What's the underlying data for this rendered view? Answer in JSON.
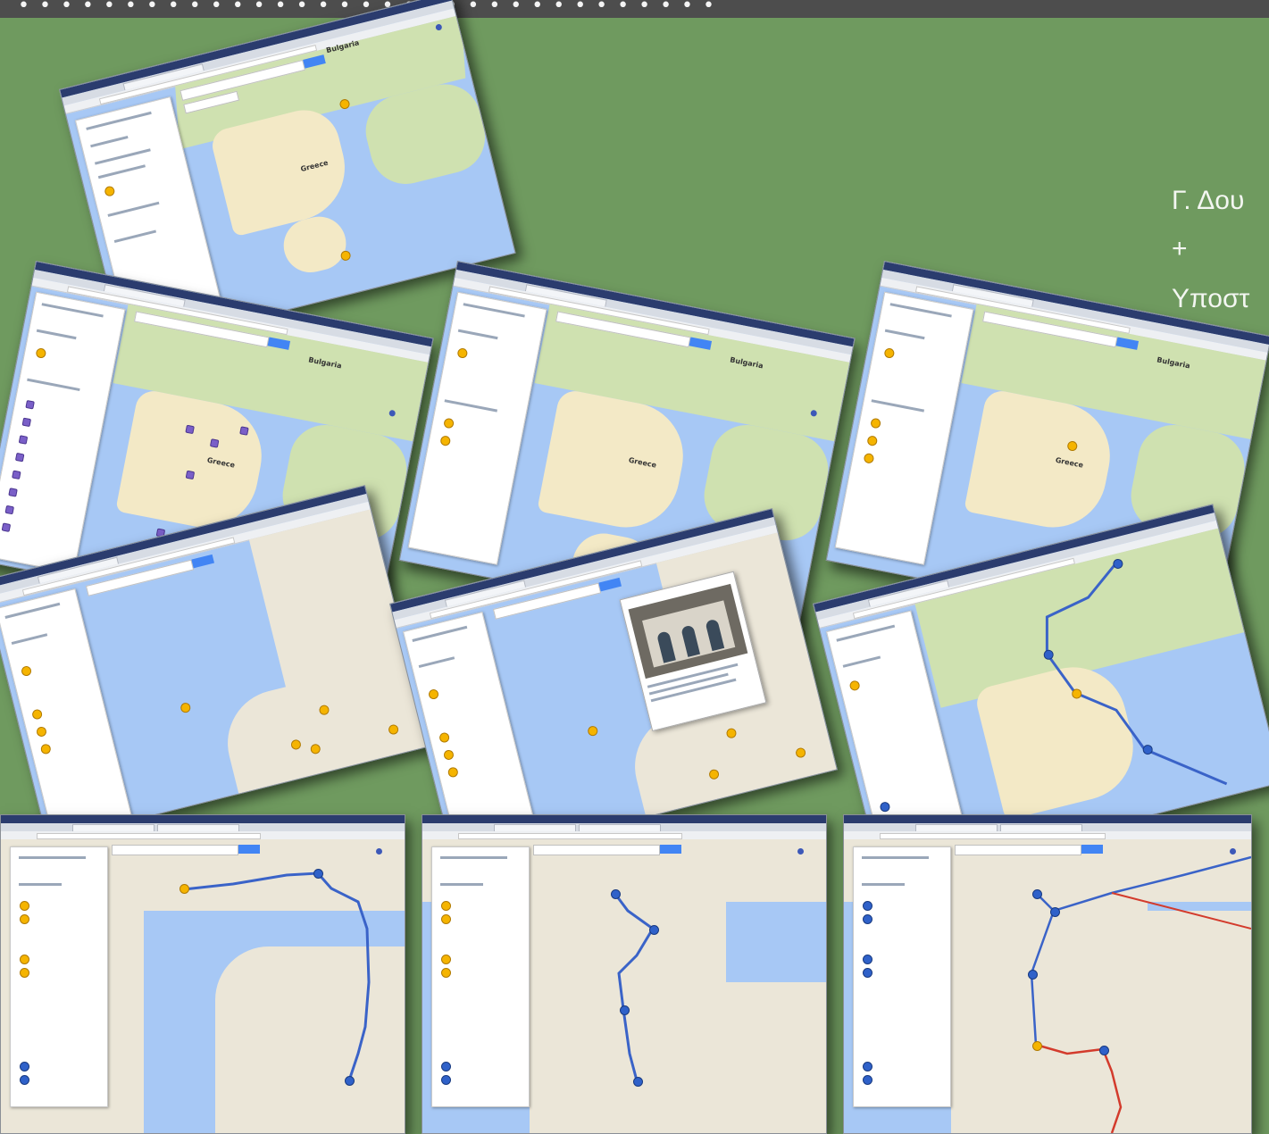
{
  "header": {
    "top_strip_text": "• •   •  • •   •     • • •     • •   •   • • •    •    •    • • •    •    •  •    •   •   • • •  •   •   •  •   •",
    "side_line1": "Γ. Δου",
    "side_line2": "+",
    "side_line3": "Υποστ"
  },
  "map_labels": {
    "bulgaria": "Bulgaria",
    "greece": "Greece"
  },
  "colors": {
    "background": "#6f9a5f",
    "top_strip": "#4d4d4d",
    "sea": "#a7c8f5",
    "route_blue": "#3a63c8",
    "route_red": "#d33b2c",
    "marker_yellow": "#f5b400",
    "marker_purple": "#7a5fc8"
  },
  "icons": [
    "search-icon",
    "map-pin-icon",
    "route-line",
    "zoom-control-icon"
  ]
}
